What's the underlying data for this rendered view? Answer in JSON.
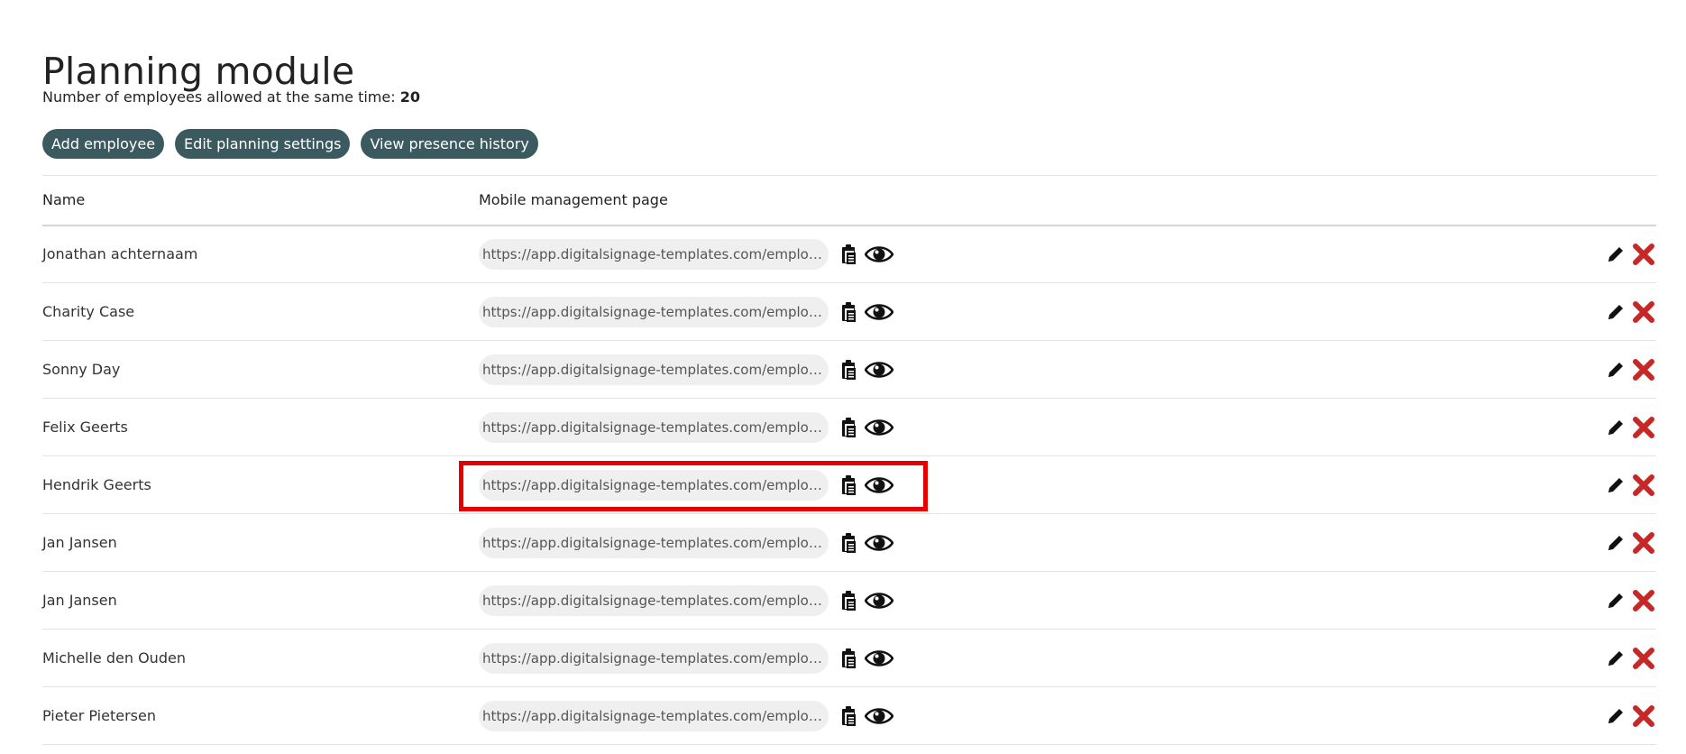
{
  "header": {
    "title": "Planning module",
    "allowed_label": "Number of employees allowed at the same time: ",
    "allowed_value": "20"
  },
  "buttons": {
    "add": "Add employee",
    "edit_settings": "Edit planning settings",
    "history": "View presence history"
  },
  "table": {
    "columns": [
      "Name",
      "Mobile management page"
    ],
    "rows": [
      {
        "name": "Jonathan achternaam",
        "url": "https://app.digitalsignage-templates.com/employee-portal"
      },
      {
        "name": "Charity Case",
        "url": "https://app.digitalsignage-templates.com/employee-portal"
      },
      {
        "name": "Sonny Day",
        "url": "https://app.digitalsignage-templates.com/employee-portal"
      },
      {
        "name": "Felix Geerts",
        "url": "https://app.digitalsignage-templates.com/employee-portal"
      },
      {
        "name": "Hendrik Geerts",
        "url": "https://app.digitalsignage-templates.com/employee-portal"
      },
      {
        "name": "Jan Jansen",
        "url": "https://app.digitalsignage-templates.com/employee-portal"
      },
      {
        "name": "Jan Jansen",
        "url": "https://app.digitalsignage-templates.com/employee-portal"
      },
      {
        "name": "Michelle den Ouden",
        "url": "https://app.digitalsignage-templates.com/employee-portal"
      },
      {
        "name": "Pieter Pietersen",
        "url": "https://app.digitalsignage-templates.com/employee-portal"
      }
    ],
    "highlighted_row": 4
  },
  "icons": {
    "copy": "clipboard-icon",
    "view": "eye-icon",
    "edit": "pencil-icon",
    "delete": "cross-icon"
  },
  "colors": {
    "button_bg": "#3b5a60",
    "delete_red": "#c62828",
    "highlight_red": "#e60000"
  }
}
